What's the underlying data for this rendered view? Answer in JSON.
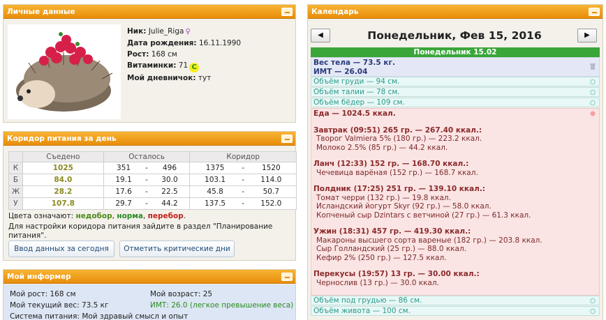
{
  "personal": {
    "header": "Личные данные",
    "nick_label": "Ник:",
    "nick_value": "Julie_Riga",
    "gender_icon": "female-symbol",
    "birth_label": "Дата рождения:",
    "birth_value": "16.11.1990",
    "height_label": "Рост:",
    "height_value": "168 см",
    "vitamins_label": "Витаминки:",
    "vitamins_value": "71",
    "vitamin_icon_letter": "C",
    "diary_label": "Мой дневничок:",
    "diary_value": "тут"
  },
  "corridor": {
    "header": "Коридор питания за день",
    "columns": [
      "Съедено",
      "Осталось",
      "Коридор"
    ],
    "rows": [
      {
        "label": "К",
        "eaten": "1025",
        "left_min": "351",
        "left_max": "496",
        "cor_min": "1375",
        "cor_max": "1520"
      },
      {
        "label": "Б",
        "eaten": "84.0",
        "left_min": "19.1",
        "left_max": "30.0",
        "cor_min": "103.1",
        "cor_max": "114.0"
      },
      {
        "label": "Ж",
        "eaten": "28.2",
        "left_min": "17.6",
        "left_max": "22.5",
        "cor_min": "45.8",
        "cor_max": "50.7"
      },
      {
        "label": "У",
        "eaten": "107.8",
        "left_min": "29.7",
        "left_max": "44.2",
        "cor_min": "137.5",
        "cor_max": "152.0"
      }
    ],
    "dash": "-",
    "legend_prefix": "Цвета означают:",
    "legend_under": "недобор",
    "legend_norm": "норма",
    "legend_over": "перебор",
    "note_line1": "Для настройки коридора питания зайдите в раздел \"Планирование",
    "note_line2": "питания\".",
    "btn_today": "Ввод данных за сегодня",
    "btn_critical": "Отметить критические дни",
    "colors": {
      "under": "#4a8a1a",
      "norm": "#2a8a22",
      "over": "#c0201a"
    }
  },
  "informer": {
    "header": "Мой информер",
    "height": "Мой рост: 168 см",
    "age": "Мой возраст: 25",
    "weight": "Мой текущий вес: 73.5 кг",
    "bmi": "ИМТ: 26.0 (легкое превышение веса)",
    "system": "Система питания: Мой здравый смысл и опыт"
  },
  "calendar": {
    "header": "Календарь",
    "prev_icon": "arrow-left",
    "next_icon": "arrow-right",
    "title": "Понедельник, Фев 15, 2016",
    "day_label": "Понедельник 15.02",
    "weight_line": "Вес тела — 73.5 кг.",
    "bmi_line": "ИМТ — 26.04",
    "measures_top": [
      "Объём груди — 94 см.",
      "Объём талии — 78 см.",
      "Объём бёдер — 109 см."
    ],
    "food": {
      "total": "Еда — 1024.5 ккал.",
      "meals": [
        {
          "title": "Завтрак (09:51) 265 гр. — 267.40 ккал.:",
          "items": [
            "Творог Valmiera 5% (180 гр.) — 223.2 ккал.",
            "Молоко 2.5% (85 гр.) — 44.2 ккал."
          ]
        },
        {
          "title": "Ланч (12:33) 152 гр. — 168.70 ккал.:",
          "items": [
            "Чечевица варёная (152 гр.) — 168.7 ккал."
          ]
        },
        {
          "title": "Полдник (17:25) 251 гр. — 139.10 ккал.:",
          "items": [
            "Томат черри (132 гр.) — 19.8 ккал.",
            "Исландский йогурт Skyr (92 гр.) — 58.0 ккал.",
            "Копченый сыр Dzintars с ветчиной (27 гр.) — 61.3 ккал."
          ]
        },
        {
          "title": "Ужин (18:31) 457 гр. — 419.30 ккал.:",
          "items": [
            "Макароны высшего сорта вареные (182 гр.) — 203.8 ккал.",
            "Сыр Голландский (25 гр.) — 88.0 ккал.",
            "Кефир 2% (250 гр.) — 127.5 ккал."
          ]
        },
        {
          "title": "Перекусы (19:57) 13 гр. — 30.00 ккал.:",
          "items": [
            "Чернослив (13 гр.) — 30.0 ккал."
          ]
        }
      ]
    },
    "measures_bottom": [
      "Объём под грудью — 86 см.",
      "Объём живота — 100 см."
    ]
  }
}
